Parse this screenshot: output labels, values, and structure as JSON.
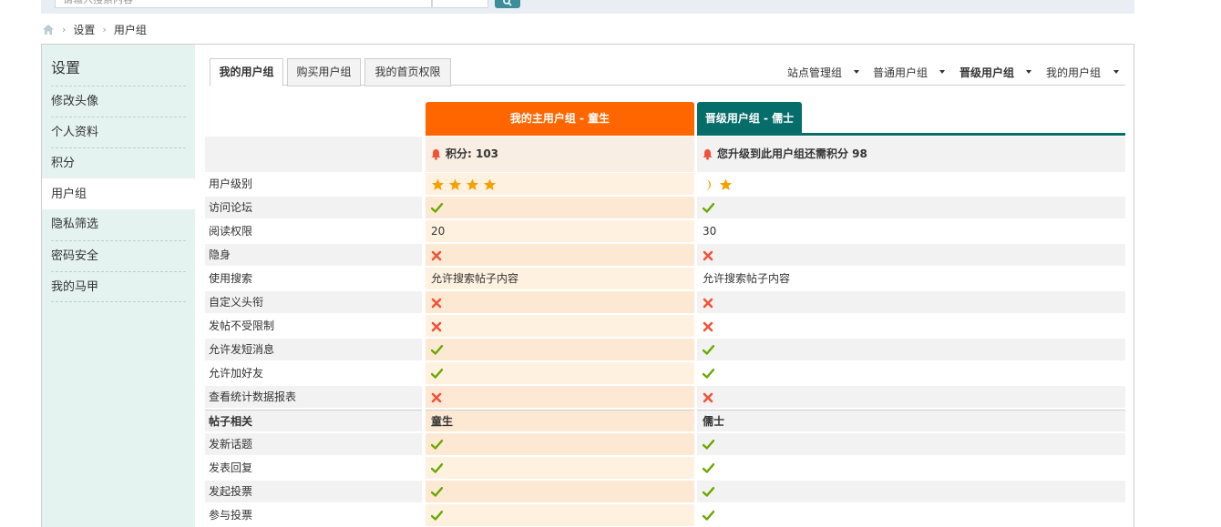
{
  "search": {
    "placeholder": "请输入搜索内容"
  },
  "breadcrumb": {
    "items": [
      "设置",
      "用户组"
    ]
  },
  "sidebar": {
    "title": "设置",
    "items": [
      "修改头像",
      "个人资料",
      "积分",
      "用户组",
      "隐私筛选",
      "密码安全",
      "我的马甲"
    ],
    "active_index": 3
  },
  "tabs": [
    "我的用户组",
    "购买用户组",
    "我的首页权限"
  ],
  "group_links": [
    "站点管理组",
    "普通用户组",
    "晋级用户组",
    "我的用户组"
  ],
  "columns": {
    "main_header": "我的主用户组 - 童生",
    "upgrade_header": "晋级用户组 - 儒士",
    "main_score": "积分: 103",
    "upgrade_score": "您升级到此用户组还需积分 98"
  },
  "rows": [
    {
      "label": "用户级别",
      "main": {
        "type": "stars",
        "stars": 4
      },
      "up": {
        "type": "stars",
        "moons": 1,
        "stars": 1
      }
    },
    {
      "label": "访问论坛",
      "main": {
        "type": "yes"
      },
      "up": {
        "type": "yes"
      }
    },
    {
      "label": "阅读权限",
      "main": {
        "type": "text",
        "text": "20"
      },
      "up": {
        "type": "text",
        "text": "30"
      }
    },
    {
      "label": "隐身",
      "main": {
        "type": "no"
      },
      "up": {
        "type": "no"
      }
    },
    {
      "label": "使用搜索",
      "main": {
        "type": "text",
        "text": "允许搜索帖子内容"
      },
      "up": {
        "type": "text",
        "text": "允许搜索帖子内容"
      }
    },
    {
      "label": "自定义头衔",
      "main": {
        "type": "no"
      },
      "up": {
        "type": "no"
      }
    },
    {
      "label": "发帖不受限制",
      "main": {
        "type": "no"
      },
      "up": {
        "type": "no"
      }
    },
    {
      "label": "允许发短消息",
      "main": {
        "type": "yes"
      },
      "up": {
        "type": "yes"
      }
    },
    {
      "label": "允许加好友",
      "main": {
        "type": "yes"
      },
      "up": {
        "type": "yes"
      }
    },
    {
      "label": "查看统计数据报表",
      "main": {
        "type": "no"
      },
      "up": {
        "type": "no"
      }
    },
    {
      "label": "帖子相关",
      "section": true,
      "main": {
        "type": "text",
        "text": "童生"
      },
      "up": {
        "type": "text",
        "text": "儒士"
      }
    },
    {
      "label": "发新话题",
      "main": {
        "type": "yes"
      },
      "up": {
        "type": "yes"
      }
    },
    {
      "label": "发表回复",
      "main": {
        "type": "yes"
      },
      "up": {
        "type": "yes"
      }
    },
    {
      "label": "发起投票",
      "main": {
        "type": "yes"
      },
      "up": {
        "type": "yes"
      }
    },
    {
      "label": "参与投票",
      "main": {
        "type": "yes"
      },
      "up": {
        "type": "yes"
      }
    }
  ],
  "colors": {
    "main_accent": "#ff6600",
    "upgrade_accent": "#066d6b",
    "sidebar_bg": "#e5f3f0",
    "yes": "#6aa800",
    "no": "#f0533a",
    "star": "#f5a000"
  }
}
